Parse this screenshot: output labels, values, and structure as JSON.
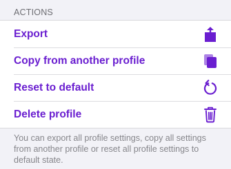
{
  "section": {
    "header": "ACTIONS",
    "accent_color": "#6a1ed0",
    "items": [
      {
        "label": "Export",
        "icon": "share-icon"
      },
      {
        "label": "Copy from another profile",
        "icon": "copy-icon"
      },
      {
        "label": "Reset to default",
        "icon": "reset-icon"
      },
      {
        "label": "Delete profile",
        "icon": "trash-icon"
      }
    ],
    "footer": "You can export all profile settings, copy all settings from another profile or reset all profile settings to default state."
  }
}
